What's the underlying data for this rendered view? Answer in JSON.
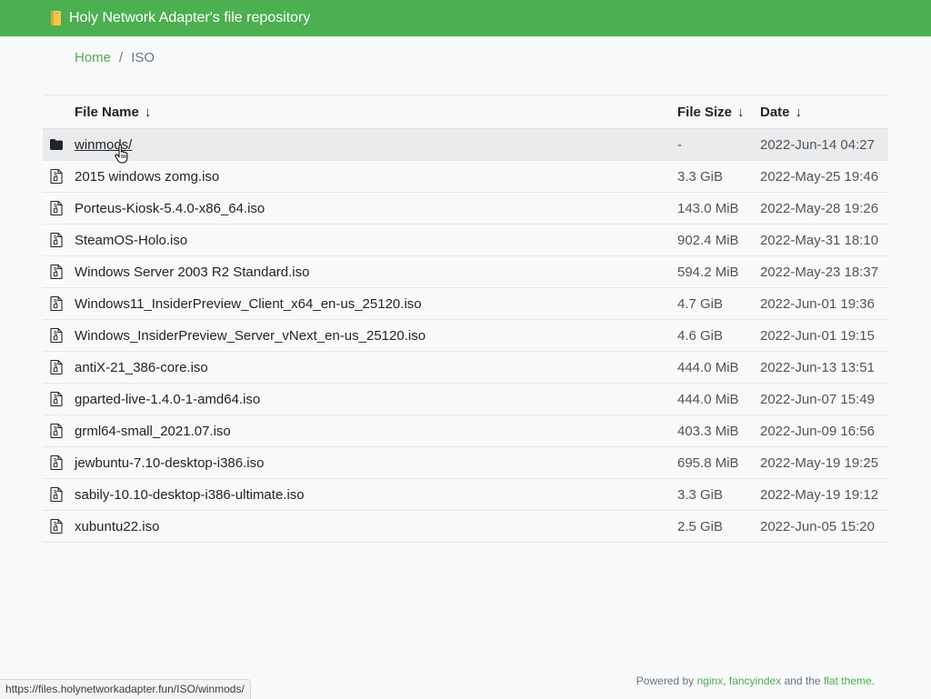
{
  "header": {
    "title": "Holy Network Adapter's file repository",
    "logo_icon": "book-icon",
    "color": "#4caf50"
  },
  "breadcrumb": {
    "home": "Home",
    "separator": "/",
    "current": "ISO"
  },
  "table": {
    "columns": {
      "name": "File Name",
      "size": "File Size",
      "date": "Date",
      "sort_arrow": "↓"
    },
    "rows": [
      {
        "name": "winmods/",
        "size": "-",
        "date": "2022-Jun-14 04:27",
        "type": "folder",
        "icon": "folder-icon"
      },
      {
        "name": "2015 windows zomg.iso",
        "size": "3.3 GiB",
        "date": "2022-May-25 19:46",
        "type": "file",
        "icon": "file-archive-icon"
      },
      {
        "name": "Porteus-Kiosk-5.4.0-x86_64.iso",
        "size": "143.0 MiB",
        "date": "2022-May-28 19:26",
        "type": "file",
        "icon": "file-archive-icon"
      },
      {
        "name": "SteamOS-Holo.iso",
        "size": "902.4 MiB",
        "date": "2022-May-31 18:10",
        "type": "file",
        "icon": "file-archive-icon"
      },
      {
        "name": "Windows Server 2003 R2 Standard.iso",
        "size": "594.2 MiB",
        "date": "2022-May-23 18:37",
        "type": "file",
        "icon": "file-archive-icon"
      },
      {
        "name": "Windows11_InsiderPreview_Client_x64_en-us_25120.iso",
        "size": "4.7 GiB",
        "date": "2022-Jun-01 19:36",
        "type": "file",
        "icon": "file-archive-icon"
      },
      {
        "name": "Windows_InsiderPreview_Server_vNext_en-us_25120.iso",
        "size": "4.6 GiB",
        "date": "2022-Jun-01 19:15",
        "type": "file",
        "icon": "file-archive-icon"
      },
      {
        "name": "antiX-21_386-core.iso",
        "size": "444.0 MiB",
        "date": "2022-Jun-13 13:51",
        "type": "file",
        "icon": "file-archive-icon"
      },
      {
        "name": "gparted-live-1.4.0-1-amd64.iso",
        "size": "444.0 MiB",
        "date": "2022-Jun-07 15:49",
        "type": "file",
        "icon": "file-archive-icon"
      },
      {
        "name": "grml64-small_2021.07.iso",
        "size": "403.3 MiB",
        "date": "2022-Jun-09 16:56",
        "type": "file",
        "icon": "file-archive-icon"
      },
      {
        "name": "jewbuntu-7.10-desktop-i386.iso",
        "size": "695.8 MiB",
        "date": "2022-May-19 19:25",
        "type": "file",
        "icon": "file-archive-icon"
      },
      {
        "name": "sabily-10.10-desktop-i386-ultimate.iso",
        "size": "3.3 GiB",
        "date": "2022-May-19 19:12",
        "type": "file",
        "icon": "file-archive-icon"
      },
      {
        "name": "xubuntu22.iso",
        "size": "2.5 GiB",
        "date": "2022-Jun-05 15:20",
        "type": "file",
        "icon": "file-archive-icon"
      }
    ]
  },
  "footer": {
    "prefix": "Powered by ",
    "link1": "nginx",
    "comma": ", ",
    "link2": "fancyindex",
    "middle": " and the ",
    "link3": "flat theme",
    "suffix": "."
  },
  "status_url": "https://files.holynetworkadapter.fun/ISO/winmods/"
}
